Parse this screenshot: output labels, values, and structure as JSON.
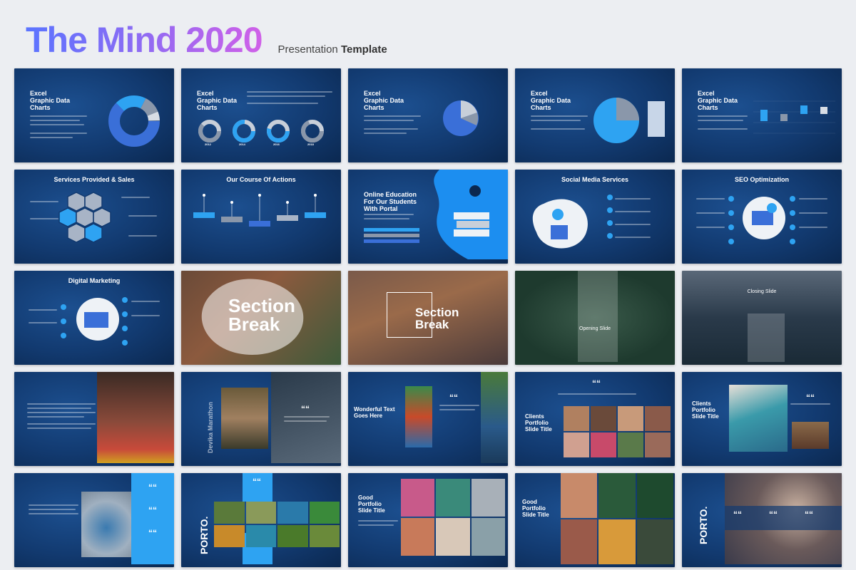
{
  "header": {
    "title": "The Mind 2020",
    "subtitle_regular": "Presentation",
    "subtitle_bold": "Template"
  },
  "slides": {
    "charts_1": "Excel Graphic Data Charts",
    "charts_2": "Excel Graphic Data Charts",
    "charts_3": "Excel Graphic Data Charts",
    "charts_4": "Excel Graphic Data Charts",
    "charts_5": "Excel Graphic Data Charts",
    "services": "Services Provided & Sales",
    "course": "Our Course Of Actions",
    "education": "Online Education For Our Students With Portal",
    "social": "Social Media Services",
    "seo": "SEO Optimization",
    "digital": "Digital Marketing",
    "section_break_1": "Section Break",
    "section_break_2": "Section Break",
    "opening": "Opening Slide",
    "closing": "Closing Slide",
    "wonderful": "Wonderful Text Goes Here",
    "clients_1": "Clients Portfolio Slide Title",
    "clients_2": "Clients Portfolio Slide Title",
    "porto_1": "PORTO.",
    "portfolio_1": "Good Portfolio Slide Title",
    "portfolio_2": "Good Portfolio Slide Title",
    "porto_2": "PORTO.",
    "marathon": "Devika Marathon",
    "quote_mark": "““",
    "year_labels": [
      "2012",
      "2014",
      "2016",
      "2018"
    ]
  },
  "colors": {
    "slide_bg": "#123a70",
    "accent": "#2ea3f2",
    "title_gradient_start": "#5b74ff",
    "title_gradient_end": "#d060e8"
  }
}
